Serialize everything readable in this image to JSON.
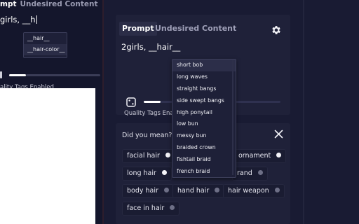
{
  "left": {
    "tab_prompt": "mpt",
    "tab_undesired": "Undesired Content",
    "prompt_text": "girls, __h",
    "suggestions": [
      "__hair__",
      "__hair-color__"
    ],
    "quality_label": "ality Tags Enabled"
  },
  "prompt_card": {
    "tab_prompt": "Prompt",
    "tab_undesired": "Undesired Content",
    "prompt_text": "2girls, __hair__",
    "quality_label": "Quality Tags Enab"
  },
  "autocomplete": {
    "items": [
      "short bob",
      "long waves",
      "straight bangs",
      "side swept bangs",
      "high ponytail",
      "low bun",
      "messy bun",
      "braided crown",
      "fishtail braid",
      "french braid"
    ],
    "highlighted_index": 0
  },
  "did_you_mean": {
    "title": "Did you mean?",
    "chips": [
      {
        "label": "facial hair",
        "dot": "white"
      },
      {
        "label": "ornament",
        "dot": "white"
      },
      {
        "label": "long hair",
        "dot": "white"
      },
      {
        "label": "rand",
        "dot": "gray"
      },
      {
        "label": "body hair",
        "dot": "gray"
      },
      {
        "label": "hand hair",
        "dot": "gray"
      },
      {
        "label": "hair weapon",
        "dot": "gray"
      },
      {
        "label": "face in hair",
        "dot": "gray"
      }
    ]
  },
  "colors": {
    "background": "#13152b",
    "panel": "#1f2139",
    "dropdown": "#1e2038",
    "text": "#ffffff"
  }
}
